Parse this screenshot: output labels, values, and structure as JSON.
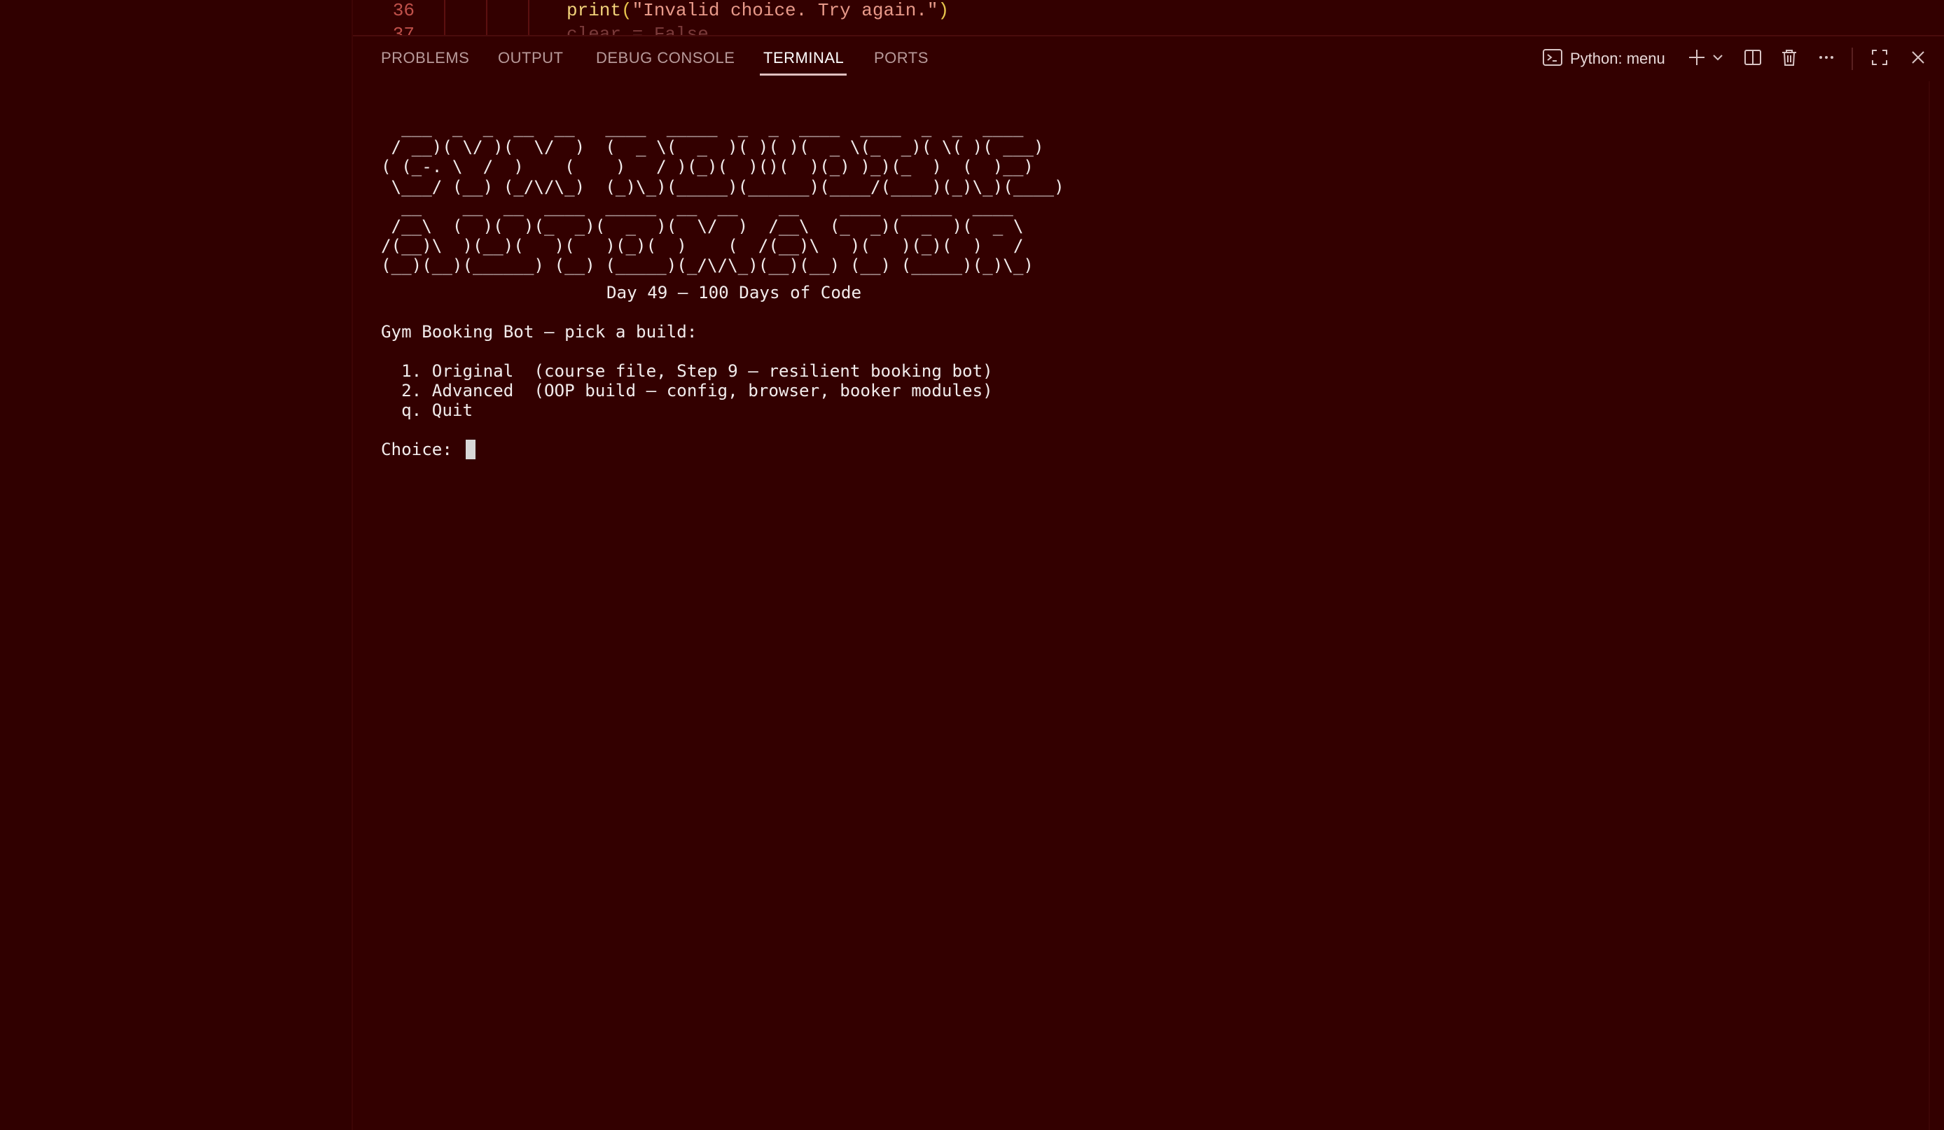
{
  "editor": {
    "lines": [
      {
        "number": "36",
        "code_fn": "print",
        "code_open": "(",
        "code_str": "\"Invalid choice. Try again.\"",
        "code_close": ")"
      },
      {
        "number": "37",
        "code_partial": "clear = False"
      }
    ]
  },
  "panel": {
    "tabs": [
      {
        "label": "PROBLEMS",
        "active": false
      },
      {
        "label": "OUTPUT",
        "active": false
      },
      {
        "label": "DEBUG CONSOLE",
        "active": false
      },
      {
        "label": "TERMINAL",
        "active": true
      },
      {
        "label": "PORTS",
        "active": false
      }
    ],
    "toolbar": {
      "terminal_name": "Python: menu",
      "icons": [
        "terminal-icon",
        "plus-icon",
        "chevron-down-icon",
        "split-icon",
        "trash-icon",
        "ellipsis-icon",
        "maximize-icon",
        "close-icon"
      ]
    }
  },
  "terminal": {
    "ascii_art": "  ___  _  _  __  __   ____  _____  _  _  ____  ____  _  _  ____ \n / __)( \\/ )(  \\/  )  (  _ \\(  _  )( )( )(  _ \\(_  _)( \\( )( ___)\n( (_-. \\  /  )    (    )   / )(_)(  )()(  )(_) )_)(_  )  (  )__) \n \\___/ (__) (_/\\/\\_)  (_)\\_)(_____)(______)(____/(____)(_)\\_)(____)\n  __    __  __  ____  _____  __  __    __    ____  _____  ____ \n /__\\  (  )(  )(_  _)(  _  )(  \\/  )  /__\\  (_  _)(  _  )(  _ \\\n/(__)\\  )(__)(   )(   )(_)(  )    (  /(__)\\   )(   )(_)(  )   /\n(__)(__)(______) (__) (_____)(_/\\/\\_)(__)(__) (__) (_____)(_)\\_)",
    "subtitle": "Day 49 — 100 Days of Code",
    "prompt_title": "Gym Booking Bot — pick a build:",
    "options": [
      "  1. Original  (course file, Step 9 — resilient booking bot)",
      "  2. Advanced  (OOP build — config, browser, booker modules)",
      "  q. Quit"
    ],
    "input_label": "Choice: "
  },
  "colors": {
    "background": "#330000",
    "text": "#f2ecec",
    "line_number": "#c0504a",
    "function": "#f2d27a",
    "string": "#e89a8a"
  }
}
